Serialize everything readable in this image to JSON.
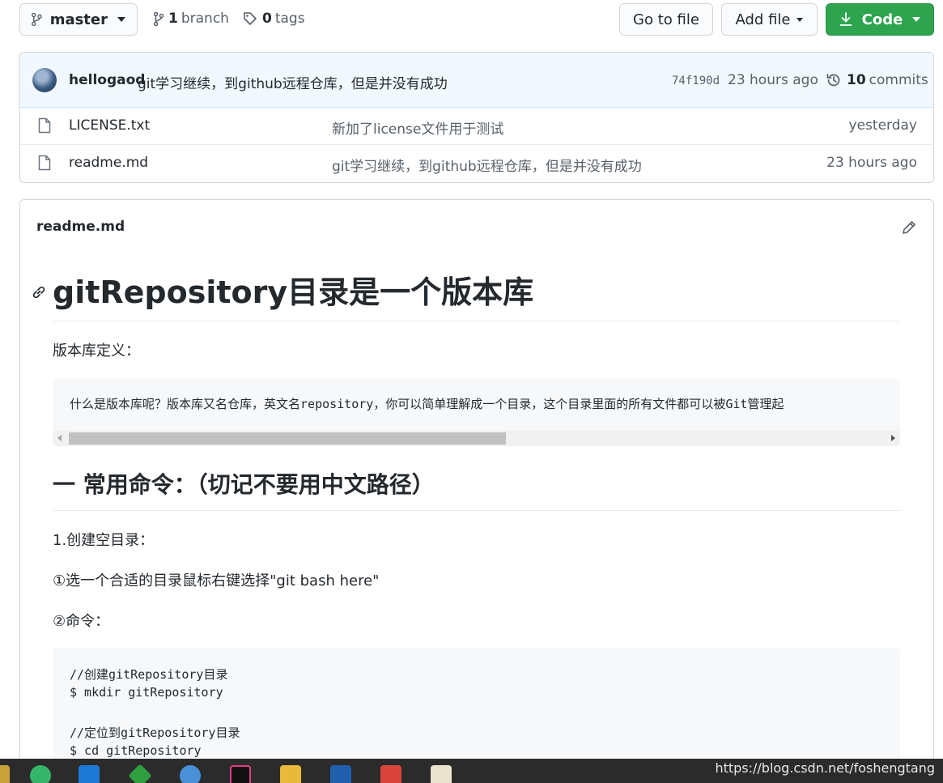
{
  "toolbar": {
    "branch_button": "master",
    "branches_count": "1",
    "branches_label": "branch",
    "tags_count": "0",
    "tags_label": "tags",
    "go_to_file": "Go to file",
    "add_file": "Add file",
    "code": "Code"
  },
  "latest_commit": {
    "author": "hellogaod",
    "message": "git学习继续，到github远程仓库，但是并没有成功",
    "sha": "74f190d",
    "age": "23 hours ago",
    "commits_count": "10",
    "commits_label": "commits"
  },
  "files": [
    {
      "name": "LICENSE.txt",
      "message": "新加了license文件用于测试",
      "age": "yesterday"
    },
    {
      "name": "readme.md",
      "message": "git学习继续，到github远程仓库，但是并没有成功",
      "age": "23 hours ago"
    }
  ],
  "readme": {
    "filename": "readme.md",
    "h1": "gitRepository目录是一个版本库",
    "p1": "版本库定义：",
    "code1": "什么是版本库呢？版本库又名仓库，英文名repository，你可以简单理解成一个目录，这个目录里面的所有文件都可以被Git管理起",
    "h2": "一 常用命令：（切记不要用中文路径）",
    "p2": "1.创建空目录：",
    "p3": "①选一个合适的目录鼠标右键选择\"git bash here\"",
    "p4": "②命令：",
    "code2": [
      "//创建gitRepository目录",
      "$ mkdir gitRepository",
      "",
      "//定位到gitRepository目录",
      "$ cd gitRepository"
    ]
  },
  "watermark": "https://blog.csdn.net/foshengtang",
  "colors": {
    "code_button": "#2ea44f",
    "commit_bar": "#f1f8ff"
  }
}
